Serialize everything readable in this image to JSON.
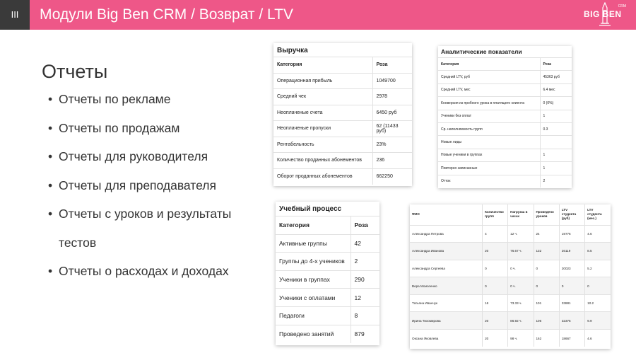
{
  "header": {
    "section_number": "III",
    "title": "Модули Big Ben CRM / Возврат / LTV",
    "logo_text": "BIG BEN",
    "logo_sub": "CRM",
    "accent_color": "#ee5788"
  },
  "left": {
    "heading": "Отчеты",
    "bullets": [
      "Отчеты по рекламе",
      "Отчеты по продажам",
      "Отчеты для руководителя",
      "Отчеты для преподавателя",
      "Отчеты с уроков и результаты тестов",
      "Отчеты о расходах и доходах"
    ]
  },
  "revenue": {
    "title": "Выручка",
    "col_category": "Категория",
    "col_value": "Роза",
    "rows": [
      {
        "label": "Операционная прибыль",
        "value": "1049700",
        "link": true
      },
      {
        "label": "Средний чек",
        "value": "2978",
        "link": true
      },
      {
        "label": "Неоплаченые счета",
        "value": "6450 руб",
        "link": false
      },
      {
        "label": "Неоплаченые пропуски",
        "value": "62 (11433 руб)",
        "link": true
      },
      {
        "label": "Рентабельность",
        "value": "23%",
        "link": true
      },
      {
        "label": "Количество проданных абонементов",
        "value": "236",
        "link": false
      },
      {
        "label": "Оборот проданных абонементов",
        "value": "662250",
        "link": false
      }
    ]
  },
  "analytics": {
    "title": "Аналитические показатели",
    "col_category": "Категория",
    "col_value": "Роза",
    "rows": [
      {
        "label": "Средний LTV, руб",
        "value": "45363 руб",
        "link": true
      },
      {
        "label": "Средний LTV, мес",
        "value": "6.4 мес",
        "link": true
      },
      {
        "label": "Конверсия из пробного урока в платящего клиента",
        "value": "0 (0%)",
        "link": false
      },
      {
        "label": "Ученики без оплат",
        "value": "1",
        "link": false
      },
      {
        "label": "Ср. наполняемость групп",
        "value": "0.3",
        "link": false
      },
      {
        "label": "Новые лиды",
        "value": "",
        "link": false
      },
      {
        "label": "Новые ученики в группах",
        "value": "1",
        "link": true
      },
      {
        "label": "Повторно записанные",
        "value": "1",
        "link": true
      },
      {
        "label": "Отток",
        "value": "2",
        "link": true
      }
    ]
  },
  "study": {
    "title": "Учебный процесс",
    "col_category": "Категория",
    "col_value": "Роза",
    "rows": [
      {
        "label": "Активные группы",
        "value": "42",
        "link": false
      },
      {
        "label": "Группы до 4-х учеников",
        "value": "2",
        "link": false
      },
      {
        "label": "Ученики в группах",
        "value": "290",
        "link": false
      },
      {
        "label": "Ученики с оплатами",
        "value": "12",
        "link": false
      },
      {
        "label": "Педагоги",
        "value": "8",
        "link": true
      },
      {
        "label": "Проведено занятий",
        "value": "879",
        "link": false
      }
    ]
  },
  "teachers": {
    "headers": [
      "ФИО",
      "Количество групп",
      "Нагрузка в часах",
      "Проведено уроков",
      "LTV студента (руб)",
      "LTV студента (мес.)"
    ],
    "rows": [
      [
        "Александра Петрова",
        "4",
        "12 ч.",
        "24",
        "19776",
        "4.6"
      ],
      [
        "Александра Иванова",
        "20",
        "76.67 ч.",
        "132",
        "26119",
        "8.5"
      ],
      [
        "Александра Сергеева",
        "0",
        "0 ч.",
        "0",
        "20023",
        "5.2"
      ],
      [
        "Вера Моисеенко",
        "0",
        "0 ч.",
        "0",
        "0",
        "0"
      ],
      [
        "Татьяна Иванчук",
        "16",
        "73.33 ч.",
        "101",
        "33881",
        "10.2"
      ],
      [
        "Ирина Тихомирова",
        "20",
        "86.92 ч.",
        "106",
        "32375",
        "9.9"
      ],
      [
        "Оксана Яковлева",
        "20",
        "98 ч.",
        "162",
        "18667",
        "4.6"
      ]
    ]
  }
}
